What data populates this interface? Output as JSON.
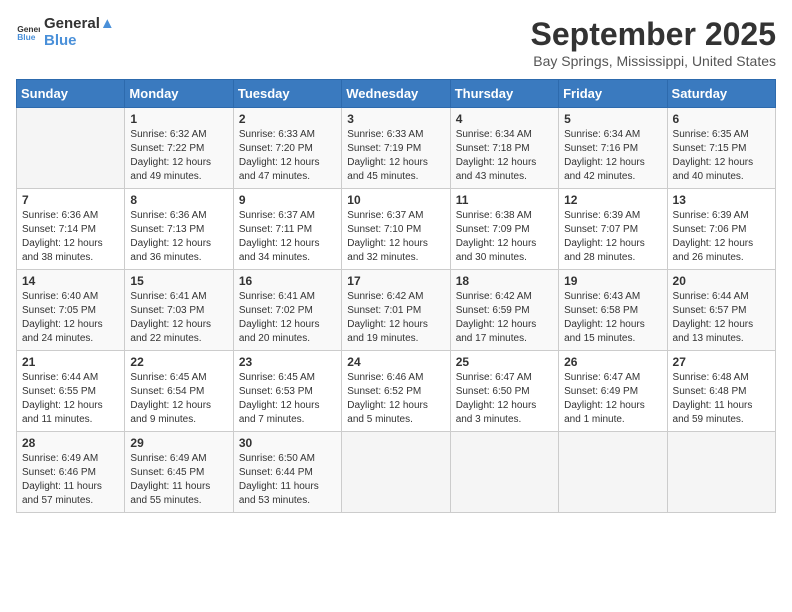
{
  "header": {
    "logo_general": "General",
    "logo_blue": "Blue",
    "month_title": "September 2025",
    "location": "Bay Springs, Mississippi, United States"
  },
  "weekdays": [
    "Sunday",
    "Monday",
    "Tuesday",
    "Wednesday",
    "Thursday",
    "Friday",
    "Saturday"
  ],
  "weeks": [
    [
      {
        "day": "",
        "info": ""
      },
      {
        "day": "1",
        "info": "Sunrise: 6:32 AM\nSunset: 7:22 PM\nDaylight: 12 hours\nand 49 minutes."
      },
      {
        "day": "2",
        "info": "Sunrise: 6:33 AM\nSunset: 7:20 PM\nDaylight: 12 hours\nand 47 minutes."
      },
      {
        "day": "3",
        "info": "Sunrise: 6:33 AM\nSunset: 7:19 PM\nDaylight: 12 hours\nand 45 minutes."
      },
      {
        "day": "4",
        "info": "Sunrise: 6:34 AM\nSunset: 7:18 PM\nDaylight: 12 hours\nand 43 minutes."
      },
      {
        "day": "5",
        "info": "Sunrise: 6:34 AM\nSunset: 7:16 PM\nDaylight: 12 hours\nand 42 minutes."
      },
      {
        "day": "6",
        "info": "Sunrise: 6:35 AM\nSunset: 7:15 PM\nDaylight: 12 hours\nand 40 minutes."
      }
    ],
    [
      {
        "day": "7",
        "info": "Sunrise: 6:36 AM\nSunset: 7:14 PM\nDaylight: 12 hours\nand 38 minutes."
      },
      {
        "day": "8",
        "info": "Sunrise: 6:36 AM\nSunset: 7:13 PM\nDaylight: 12 hours\nand 36 minutes."
      },
      {
        "day": "9",
        "info": "Sunrise: 6:37 AM\nSunset: 7:11 PM\nDaylight: 12 hours\nand 34 minutes."
      },
      {
        "day": "10",
        "info": "Sunrise: 6:37 AM\nSunset: 7:10 PM\nDaylight: 12 hours\nand 32 minutes."
      },
      {
        "day": "11",
        "info": "Sunrise: 6:38 AM\nSunset: 7:09 PM\nDaylight: 12 hours\nand 30 minutes."
      },
      {
        "day": "12",
        "info": "Sunrise: 6:39 AM\nSunset: 7:07 PM\nDaylight: 12 hours\nand 28 minutes."
      },
      {
        "day": "13",
        "info": "Sunrise: 6:39 AM\nSunset: 7:06 PM\nDaylight: 12 hours\nand 26 minutes."
      }
    ],
    [
      {
        "day": "14",
        "info": "Sunrise: 6:40 AM\nSunset: 7:05 PM\nDaylight: 12 hours\nand 24 minutes."
      },
      {
        "day": "15",
        "info": "Sunrise: 6:41 AM\nSunset: 7:03 PM\nDaylight: 12 hours\nand 22 minutes."
      },
      {
        "day": "16",
        "info": "Sunrise: 6:41 AM\nSunset: 7:02 PM\nDaylight: 12 hours\nand 20 minutes."
      },
      {
        "day": "17",
        "info": "Sunrise: 6:42 AM\nSunset: 7:01 PM\nDaylight: 12 hours\nand 19 minutes."
      },
      {
        "day": "18",
        "info": "Sunrise: 6:42 AM\nSunset: 6:59 PM\nDaylight: 12 hours\nand 17 minutes."
      },
      {
        "day": "19",
        "info": "Sunrise: 6:43 AM\nSunset: 6:58 PM\nDaylight: 12 hours\nand 15 minutes."
      },
      {
        "day": "20",
        "info": "Sunrise: 6:44 AM\nSunset: 6:57 PM\nDaylight: 12 hours\nand 13 minutes."
      }
    ],
    [
      {
        "day": "21",
        "info": "Sunrise: 6:44 AM\nSunset: 6:55 PM\nDaylight: 12 hours\nand 11 minutes."
      },
      {
        "day": "22",
        "info": "Sunrise: 6:45 AM\nSunset: 6:54 PM\nDaylight: 12 hours\nand 9 minutes."
      },
      {
        "day": "23",
        "info": "Sunrise: 6:45 AM\nSunset: 6:53 PM\nDaylight: 12 hours\nand 7 minutes."
      },
      {
        "day": "24",
        "info": "Sunrise: 6:46 AM\nSunset: 6:52 PM\nDaylight: 12 hours\nand 5 minutes."
      },
      {
        "day": "25",
        "info": "Sunrise: 6:47 AM\nSunset: 6:50 PM\nDaylight: 12 hours\nand 3 minutes."
      },
      {
        "day": "26",
        "info": "Sunrise: 6:47 AM\nSunset: 6:49 PM\nDaylight: 12 hours\nand 1 minute."
      },
      {
        "day": "27",
        "info": "Sunrise: 6:48 AM\nSunset: 6:48 PM\nDaylight: 11 hours\nand 59 minutes."
      }
    ],
    [
      {
        "day": "28",
        "info": "Sunrise: 6:49 AM\nSunset: 6:46 PM\nDaylight: 11 hours\nand 57 minutes."
      },
      {
        "day": "29",
        "info": "Sunrise: 6:49 AM\nSunset: 6:45 PM\nDaylight: 11 hours\nand 55 minutes."
      },
      {
        "day": "30",
        "info": "Sunrise: 6:50 AM\nSunset: 6:44 PM\nDaylight: 11 hours\nand 53 minutes."
      },
      {
        "day": "",
        "info": ""
      },
      {
        "day": "",
        "info": ""
      },
      {
        "day": "",
        "info": ""
      },
      {
        "day": "",
        "info": ""
      }
    ]
  ]
}
